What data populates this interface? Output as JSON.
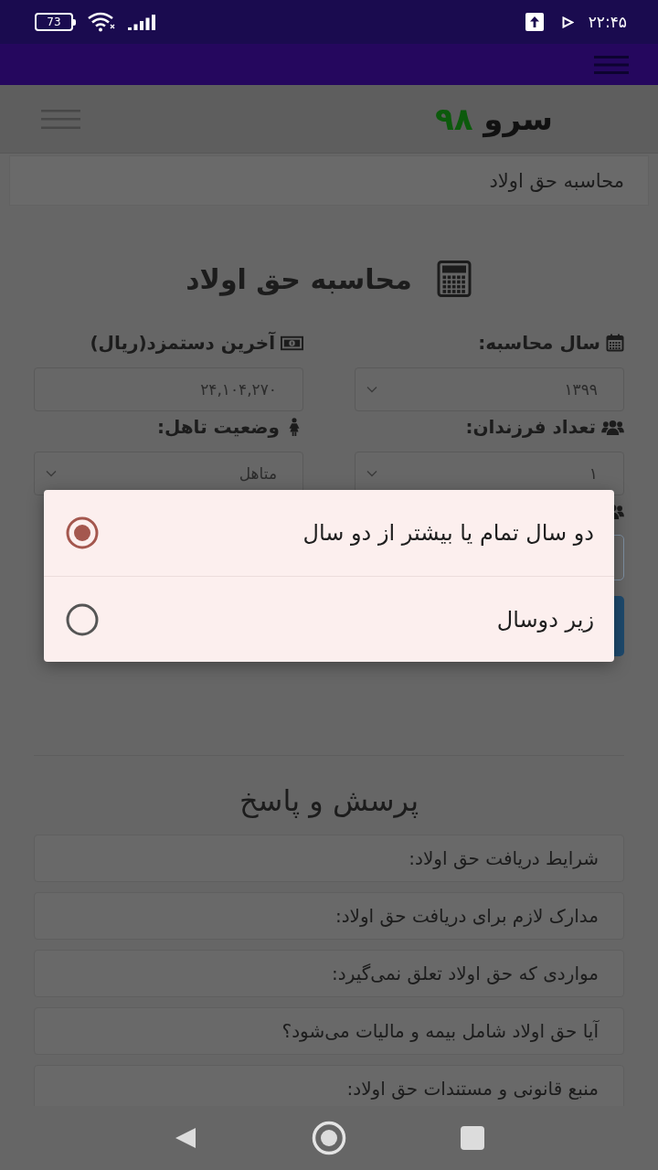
{
  "status_bar": {
    "battery": "73",
    "time": "۲۲:۴۵"
  },
  "header": {
    "logo_name": "سرو",
    "logo_number": "۹۸"
  },
  "breadcrumb": "محاسبه حق اولاد",
  "calculator": {
    "title": "محاسبه حق اولاد",
    "fields": [
      {
        "label": "سال محاسبه:",
        "kind": "select",
        "value": "۱۳۹۹"
      },
      {
        "label": "آخرین دستمزد(ریال)",
        "kind": "input",
        "value": "۲۴,۱۰۴,۲۷۰"
      },
      {
        "label": "تعداد فرزندان:",
        "kind": "select",
        "value": "۱"
      },
      {
        "label": "وضعیت تاهل:",
        "kind": "select",
        "value": "متاهل"
      }
    ]
  },
  "dialog": {
    "options": [
      {
        "label": "دو سال تمام یا بیشتر از دو سال",
        "selected": true
      },
      {
        "label": "زیر دوسال",
        "selected": false
      }
    ]
  },
  "faq": {
    "title": "پرسش و پاسخ",
    "items": [
      "شرایط دریافت حق اولاد:",
      "مدارک لازم برای دریافت حق اولاد:",
      "مواردی که حق اولاد تعلق نمی‌گیرد:",
      "آیا حق اولاد شامل بیمه و مالیات می‌شود؟",
      "منبع قانونی و مستندات حق اولاد:"
    ]
  }
}
